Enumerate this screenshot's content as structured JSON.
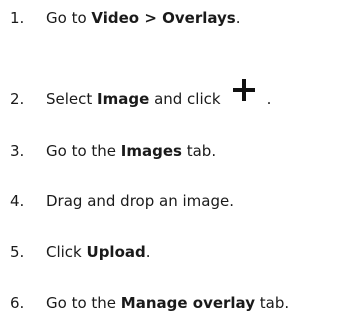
{
  "steps": [
    {
      "num": "1.",
      "parts": [
        "Go to ",
        "Video > Overlays",
        "."
      ]
    },
    {
      "num": "2.",
      "parts": [
        "Select ",
        "Image",
        " and click",
        "."
      ]
    },
    {
      "num": "3.",
      "parts": [
        "Go to the ",
        "Images",
        " tab."
      ]
    },
    {
      "num": "4.",
      "parts": [
        "Drag and drop an image."
      ]
    },
    {
      "num": "5.",
      "parts": [
        "Click ",
        "Upload",
        "."
      ]
    },
    {
      "num": "6.",
      "parts": [
        "Go to the ",
        "Manage overlay",
        " tab."
      ]
    }
  ],
  "icons": {
    "step2": "plus-icon"
  }
}
